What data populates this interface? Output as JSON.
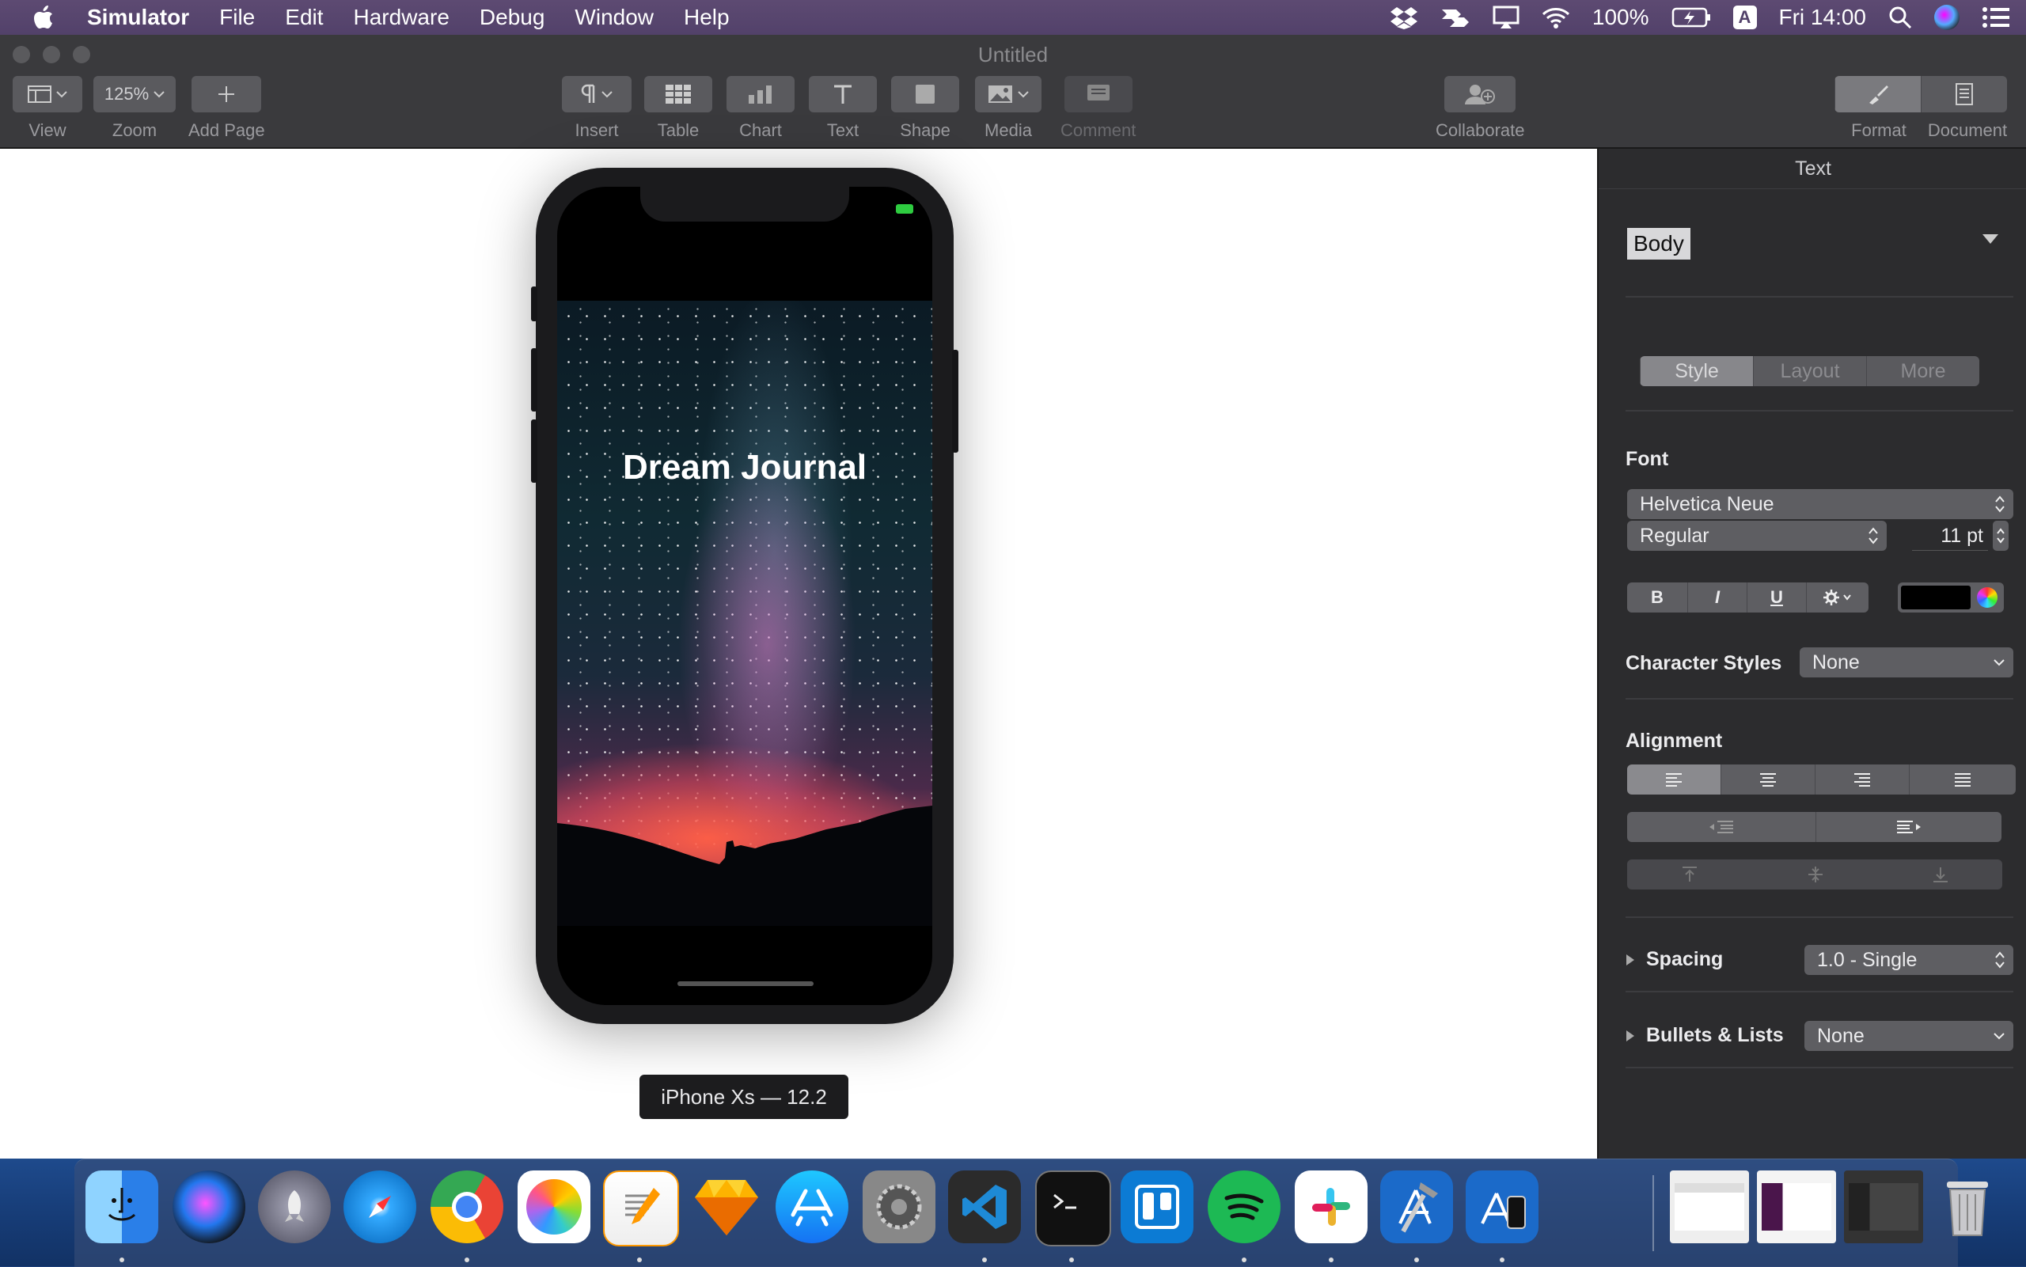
{
  "menubar": {
    "app_name": "Simulator",
    "items": [
      "File",
      "Edit",
      "Hardware",
      "Debug",
      "Window",
      "Help"
    ],
    "battery": "100%",
    "keyboard": "A",
    "clock": "Fri 14:00"
  },
  "window": {
    "title": "Untitled"
  },
  "toolbar": {
    "view_label": "View",
    "zoom_value": "125%",
    "zoom_label": "Zoom",
    "add_page_label": "Add Page",
    "insert_label": "Insert",
    "table_label": "Table",
    "chart_label": "Chart",
    "text_label": "Text",
    "shape_label": "Shape",
    "media_label": "Media",
    "comment_label": "Comment",
    "collaborate_label": "Collaborate",
    "format_label": "Format",
    "document_label": "Document"
  },
  "simulator": {
    "app_title": "Dream Journal",
    "device_label": "iPhone Xs — 12.2"
  },
  "inspector": {
    "header": "Text",
    "paragraph_style": "Body",
    "tabs": [
      "Style",
      "Layout",
      "More"
    ],
    "font_label": "Font",
    "font_family": "Helvetica Neue",
    "font_weight": "Regular",
    "font_size": "11 pt",
    "format_buttons": [
      "B",
      "I",
      "U"
    ],
    "character_styles_label": "Character Styles",
    "character_styles_value": "None",
    "alignment_label": "Alignment",
    "spacing_label": "Spacing",
    "spacing_value": "1.0 - Single",
    "bullets_label": "Bullets & Lists",
    "bullets_value": "None"
  },
  "dock": {
    "apps": [
      "finder",
      "siri",
      "launchpad",
      "safari",
      "chrome",
      "photos",
      "pages",
      "sketch",
      "app-store",
      "system-preferences",
      "visual-studio-code",
      "terminal",
      "trello",
      "spotify",
      "slack",
      "xcode",
      "simulator"
    ],
    "running": [
      "finder",
      "chrome",
      "pages",
      "visual-studio-code",
      "terminal",
      "spotify",
      "slack",
      "xcode",
      "simulator"
    ]
  },
  "colors": {
    "menubar": "#52416a",
    "toolbar": "#3a3a3d",
    "inspector": "#2c2c2e",
    "dock": "#173d78"
  }
}
